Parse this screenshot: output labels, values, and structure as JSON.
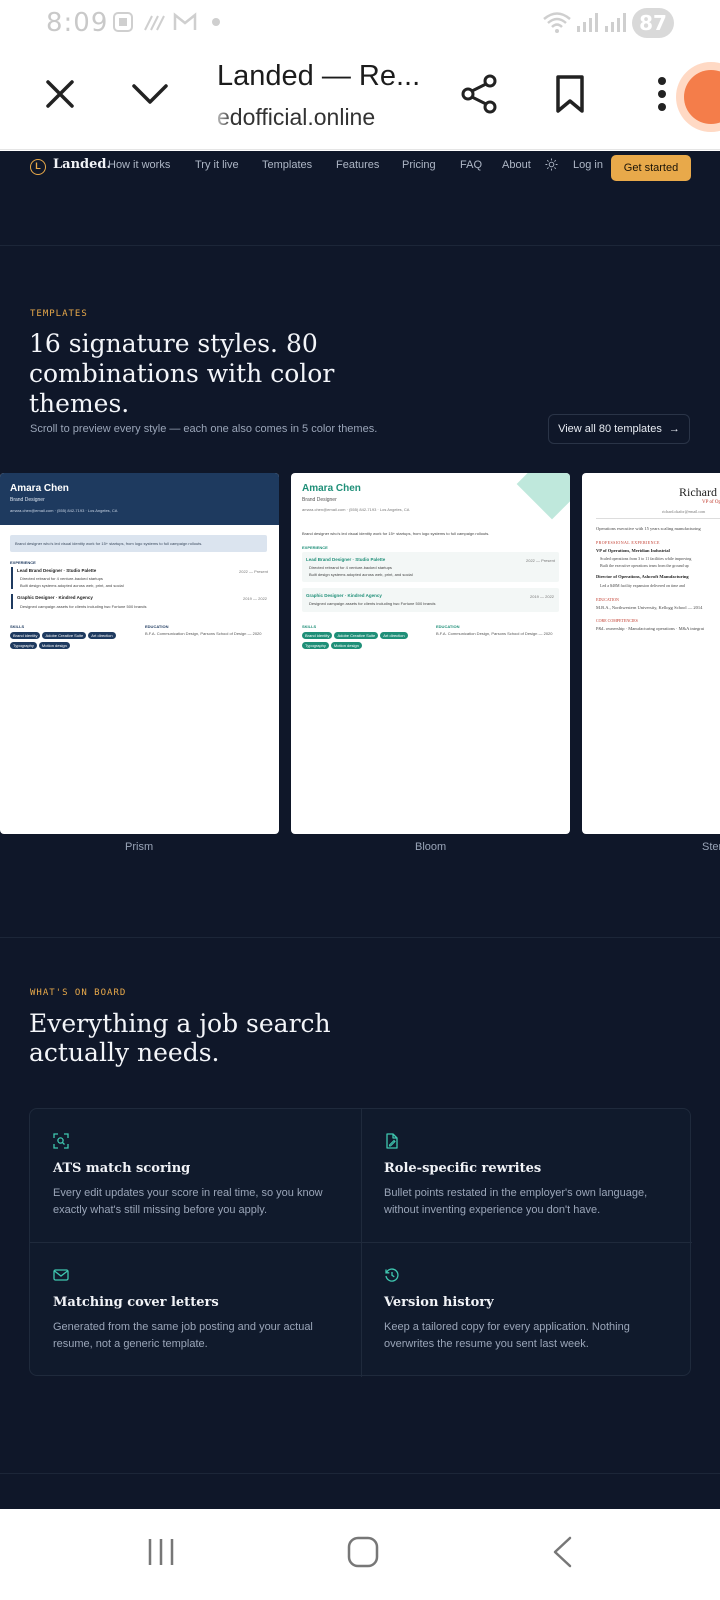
{
  "status_bar": {
    "time": "8:09",
    "battery": "87",
    "icons": [
      "screenshot-icon",
      "signal-strength-icon",
      "gmail-icon",
      "dot-icon",
      "wifi-icon",
      "signal-icon",
      "signal-icon-2",
      "battery-icon"
    ]
  },
  "browser": {
    "tab_title": "Landed — Re...",
    "url": "edofficial.online",
    "icons": [
      "close-icon",
      "chevron-down-icon",
      "share-icon",
      "bookmark-icon",
      "more-icon",
      "extension-icon"
    ]
  },
  "nav": {
    "brand": "Landed.",
    "logo_letter": "L",
    "links": [
      "How it works",
      "Try it live",
      "Templates",
      "Features",
      "Pricing",
      "FAQ",
      "About"
    ],
    "login": "Log in",
    "cta": "Get started",
    "theme_icon": "sun-icon"
  },
  "templates": {
    "eyebrow": "TEMPLATES",
    "heading_lines": [
      "16 signature styles. 80",
      "combinations with color",
      "themes."
    ],
    "subtitle": "Scroll to preview every style — each one also comes in 5 color themes.",
    "view_all": "View all 80 templates",
    "arrow": "→",
    "cards": [
      {
        "caption": "Prism",
        "name": "Amara Chen",
        "role": "Brand Designer",
        "contact": "amara.chen@email.com · (555) 842-7193 · Los Angeles, CA",
        "summary": "Brand designer who's led visual identity work for 15+ startups, from logo systems to full campaign rollouts.",
        "section_experience": "EXPERIENCE",
        "job1": "Lead Brand Designer · Studio Palette",
        "job1_dates": "2022 — Present",
        "job1_b1": "Directed rebrand for 4 venture-backed startups",
        "job1_b2": "Built design systems adopted across web, print, and social",
        "job2": "Graphic Designer · Kindred Agency",
        "job2_dates": "2019 — 2022",
        "job2_b1": "Designed campaign assets for clients including two Fortune 500 brands",
        "section_skills": "SKILLS",
        "skills": [
          "Brand identity",
          "Adobe Creative Suite",
          "Art direction",
          "Typography",
          "Motion design"
        ],
        "section_education": "EDUCATION",
        "education": "B.F.A. Communication Design, Parsons School of Design — 2020",
        "accent": "#1e3a5f"
      },
      {
        "caption": "Bloom",
        "name": "Amara Chen",
        "role": "Brand Designer",
        "contact": "amara.chen@email.com · (555) 842-7193 · Los Angeles, CA",
        "summary": "Brand designer who's led visual identity work for 15+ startups, from logo systems to full campaign rollouts.",
        "section_experience": "EXPERIENCE",
        "job1": "Lead Brand Designer · Studio Palette",
        "job1_dates": "2022 — Present",
        "job1_b1": "Directed rebrand for 4 venture-backed startups",
        "job1_b2": "Built design systems adopted across web, print, and social",
        "job2": "Graphic Designer · Kindred Agency",
        "job2_dates": "2019 — 2022",
        "job2_b1": "Designed campaign assets for clients including two Fortune 500 brands",
        "section_skills": "SKILLS",
        "skills": [
          "Brand identity",
          "Adobe Creative Suite",
          "Art direction",
          "Typography",
          "Motion design"
        ],
        "section_education": "EDUCATION",
        "education": "B.F.A. Communication Design, Parsons School of Design — 2020",
        "accent": "#1f8f78"
      },
      {
        "caption": "Ster",
        "name": "Richard",
        "role": "VP of Op",
        "contact": "richard.okafor@email.com",
        "summary": "Operations executive with 15 years scaling manufacturing",
        "section_experience": "PROFESSIONAL EXPERIENCE",
        "job1": "VP of Operations, Meridian Industrial",
        "job1_b1": "Scaled operations from 3 to 11 facilities while improving",
        "job1_b2": "Built the executive operations team from the ground up",
        "job2": "Director of Operations, Ashcroft Manufacturing",
        "job2_b1": "Led a $40M facility expansion delivered on time and",
        "section_education": "EDUCATION",
        "education": "M.B.A., Northwestern University, Kellogg School — 2014",
        "section_skills": "CORE COMPETENCIES",
        "skills_line": "P&L ownership · Manufacturing operations · M&A integrat",
        "accent": "#c0392b"
      }
    ]
  },
  "features": {
    "eyebrow": "WHAT'S ON BOARD",
    "heading_lines": [
      "Everything a job search",
      "actually needs."
    ],
    "items": [
      {
        "icon": "scan-search-icon",
        "title": "ATS match scoring",
        "desc": "Every edit updates your score in real time, so you know exactly what's still missing before you apply."
      },
      {
        "icon": "file-pen-icon",
        "title": "Role-specific rewrites",
        "desc": "Bullet points restated in the employer's own language, without inventing experience you don't have."
      },
      {
        "icon": "mail-icon",
        "title": "Matching cover letters",
        "desc": "Generated from the same job posting and your actual resume, not a generic template."
      },
      {
        "icon": "history-icon",
        "title": "Version history",
        "desc": "Keep a tailored copy for every application. Nothing overwrites the resume you sent last week."
      }
    ]
  },
  "system_nav": {
    "icons": [
      "recent-apps-icon",
      "home-icon",
      "back-icon"
    ]
  },
  "colors": {
    "page_bg": "#0f1729",
    "accent": "#e8a94a",
    "teal": "#3fc7b0"
  }
}
